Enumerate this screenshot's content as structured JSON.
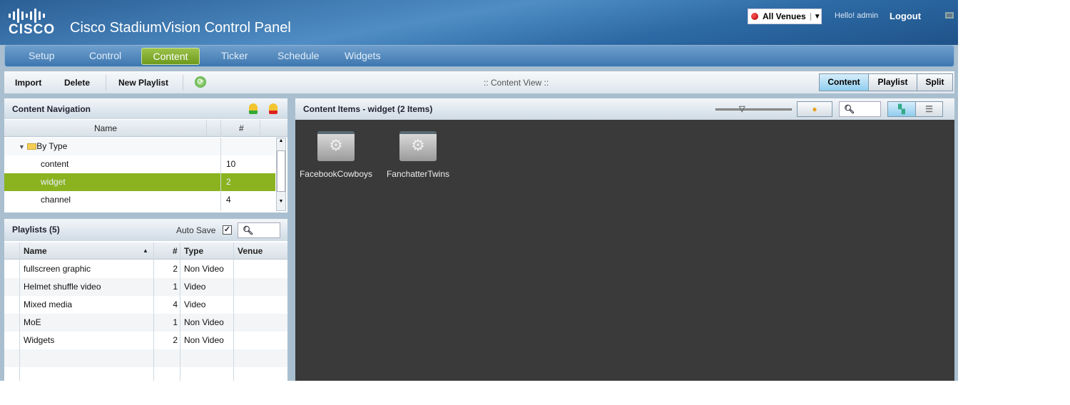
{
  "header": {
    "logo_text": "cisco",
    "title": "Cisco StadiumVision Control Panel",
    "venue_select": "All Venues",
    "greeting": "Hello! admin",
    "logout": "Logout"
  },
  "nav": {
    "tabs": [
      {
        "label": "Setup"
      },
      {
        "label": "Control"
      },
      {
        "label": "Content",
        "active": true
      },
      {
        "label": "Ticker"
      },
      {
        "label": "Schedule"
      },
      {
        "label": "Widgets"
      }
    ]
  },
  "toolbar": {
    "import": "Import",
    "delete": "Delete",
    "new_playlist": "New Playlist",
    "view_title": ":: Content View ::",
    "views": [
      "Content",
      "Playlist",
      "Split"
    ],
    "active_view": "Content"
  },
  "content_nav": {
    "title": "Content Navigation",
    "col_name": "Name",
    "col_count": "#",
    "group": "By Type",
    "items": [
      {
        "name": "content",
        "count": "10"
      },
      {
        "name": "widget",
        "count": "2",
        "selected": true
      },
      {
        "name": "channel",
        "count": "4"
      }
    ]
  },
  "playlists": {
    "title": "Playlists (5)",
    "auto_save": "Auto Save",
    "auto_save_checked": true,
    "columns": [
      "Name",
      "#",
      "Type",
      "Venue"
    ],
    "sort_indicator": "▲",
    "rows": [
      {
        "name": "fullscreen graphic",
        "count": "2",
        "type": "Non Video",
        "venue": ""
      },
      {
        "name": "Helmet shuffle video",
        "count": "1",
        "type": "Video",
        "venue": ""
      },
      {
        "name": "Mixed media",
        "count": "4",
        "type": "Video",
        "venue": ""
      },
      {
        "name": "MoE",
        "count": "1",
        "type": "Non Video",
        "venue": ""
      },
      {
        "name": "Widgets",
        "count": "2",
        "type": "Non Video",
        "venue": ""
      }
    ]
  },
  "content_items": {
    "title": "Content Items - widget (2 Items)",
    "items": [
      {
        "label": "FacebookCowboys"
      },
      {
        "label": "FanchatterTwins"
      }
    ]
  },
  "colors": {
    "accent_green": "#8ab31f",
    "header_blue": "#2d6aa5",
    "content_bg": "#3a3a3a"
  }
}
